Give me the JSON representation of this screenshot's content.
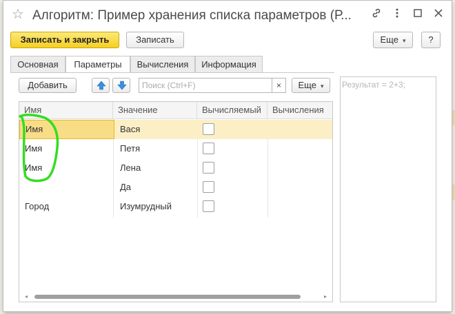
{
  "window": {
    "title": "Алгоритм: Пример хранения списка параметров (Р...",
    "icons": {
      "favorite": "star-icon",
      "link": "link-icon",
      "menu": "more-vert-icon",
      "maximize": "maximize-icon",
      "close": "close-icon"
    }
  },
  "toolbar": {
    "save_close_label": "Записать и закрыть",
    "save_label": "Записать",
    "more_label": "Еще",
    "help_label": "?"
  },
  "tabs": [
    {
      "label": "Основная",
      "active": false
    },
    {
      "label": "Параметры",
      "active": true
    },
    {
      "label": "Вычисления",
      "active": false
    },
    {
      "label": "Информация",
      "active": false
    }
  ],
  "params_toolbar": {
    "add_label": "Добавить",
    "up_icon": "arrow-up-icon",
    "down_icon": "arrow-down-icon",
    "search_placeholder": "Поиск (Ctrl+F)",
    "clear_label": "×",
    "more_label": "Еще"
  },
  "table": {
    "columns": [
      "Имя",
      "Значение",
      "Вычисляемый",
      "Вычисления"
    ],
    "rows": [
      {
        "name": "Имя",
        "value": "Вася",
        "computed": false,
        "calc": ""
      },
      {
        "name": "Имя",
        "value": "Петя",
        "computed": false,
        "calc": ""
      },
      {
        "name": "Имя",
        "value": "Лена",
        "computed": false,
        "calc": ""
      },
      {
        "name": "",
        "value": "Да",
        "computed": false,
        "calc": ""
      },
      {
        "name": "Город",
        "value": "Изумрудный",
        "computed": false,
        "calc": ""
      }
    ]
  },
  "result": {
    "placeholder": "Результат = 2+3;"
  },
  "colors": {
    "primary_button": "#f5cf24",
    "selected_row": "#fcefc6",
    "current_cell": "#f9dd86",
    "annotation": "#33dd22"
  }
}
